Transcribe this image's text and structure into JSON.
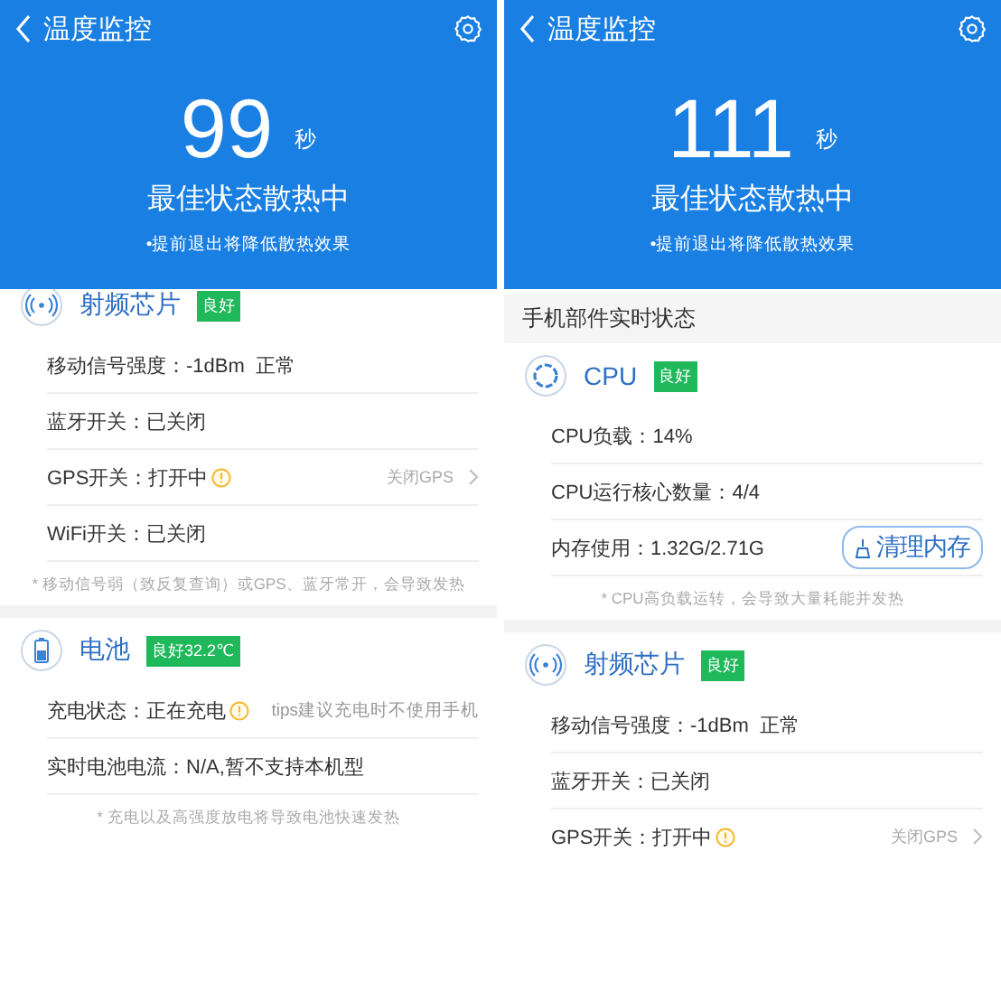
{
  "screens": [
    {
      "title": "温度监控",
      "countdown": "99",
      "unit": "秒",
      "status": "最佳状态散热中",
      "note": "•提前退出将降低散热效果",
      "sections": [
        {
          "kind": "radio",
          "name": "射频芯片",
          "badge": "良好",
          "rows": [
            {
              "text": "移动信号强度：-1dBm  正常",
              "warning": false
            },
            {
              "text": "蓝牙开关：已关闭",
              "warning": false
            },
            {
              "text": "GPS开关：打开中",
              "warning": true,
              "action": {
                "kind": "link",
                "label": "关闭GPS"
              }
            },
            {
              "text": "WiFi开关：已关闭",
              "warning": false
            }
          ],
          "footnote": "* 移动信号弱（致反复查询）或GPS、蓝牙常开，会导致发热"
        },
        {
          "kind": "battery",
          "name": "电池",
          "badge": "良好32.2℃",
          "rows": [
            {
              "text": "充电状态：正在充电",
              "warning": true,
              "action": {
                "kind": "tip",
                "label": "tips建议充电时不使用手机"
              }
            },
            {
              "text": "实时电池电流：N/A,暂不支持本机型",
              "warning": false
            }
          ],
          "footnote": "* 充电以及高强度放电将导致电池快速发热"
        }
      ]
    },
    {
      "title": "温度监控",
      "countdown": "111",
      "unit": "秒",
      "status": "最佳状态散热中",
      "note": "•提前退出将降低散热效果",
      "heading": "手机部件实时状态",
      "sections": [
        {
          "kind": "cpu",
          "name": "CPU",
          "badge": "良好",
          "rows": [
            {
              "text": "CPU负载：14%",
              "warning": false
            },
            {
              "text": "CPU运行核心数量：4/4",
              "warning": false
            },
            {
              "text": "内存使用：1.32G/2.71G",
              "warning": false,
              "action": {
                "kind": "button",
                "label": "清理内存"
              }
            }
          ],
          "footnote": "* CPU高负载运转，会导致大量耗能并发热"
        },
        {
          "kind": "radio",
          "name": "射频芯片",
          "badge": "良好",
          "rows": [
            {
              "text": "移动信号强度：-1dBm  正常",
              "warning": false
            },
            {
              "text": "蓝牙开关：已关闭",
              "warning": false
            },
            {
              "text": "GPS开关：打开中",
              "warning": true,
              "action": {
                "kind": "link",
                "label": "关闭GPS"
              }
            }
          ]
        }
      ]
    }
  ]
}
